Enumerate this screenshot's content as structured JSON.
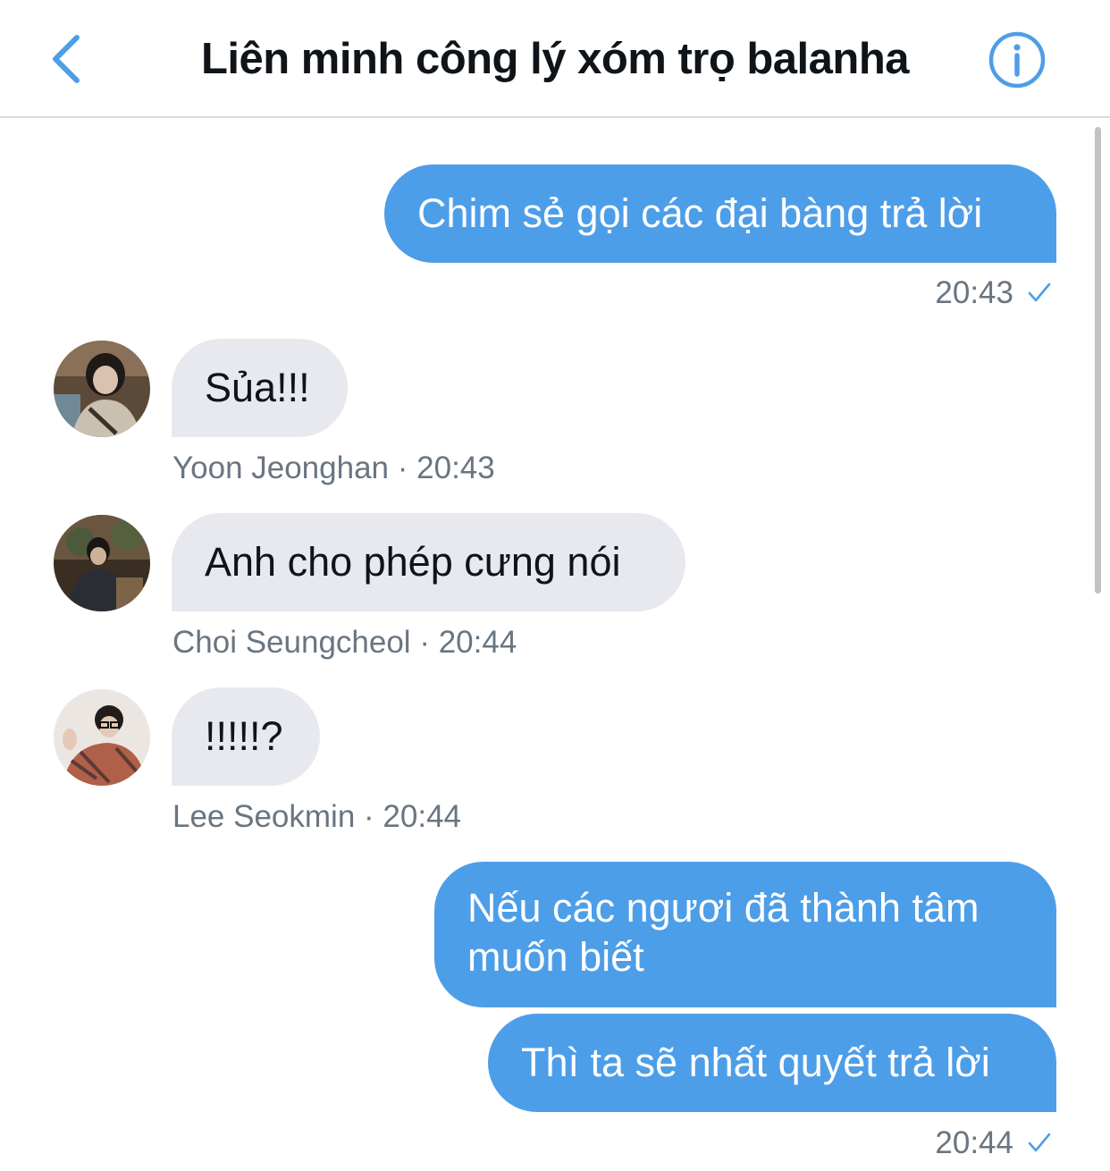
{
  "header": {
    "title": "Liên minh công lý xóm trọ balanha",
    "back_icon": "chevron-left-icon",
    "info_icon": "info-circle-icon",
    "accent": "#4d9ee8"
  },
  "messages": [
    {
      "direction": "outgoing",
      "text": "Chim sẻ gọi các đại bàng trả lời",
      "time": "20:43",
      "status": "sent-check-icon"
    },
    {
      "direction": "incoming",
      "text": "Sủa!!!",
      "sender": "Yoon Jeonghan",
      "separator": "·",
      "time": "20:43",
      "avatar": "avatar-yoon-jeonghan"
    },
    {
      "direction": "incoming",
      "text": "Anh cho phép cưng nói",
      "sender": "Choi Seungcheol",
      "separator": "·",
      "time": "20:44",
      "avatar": "avatar-choi-seungcheol"
    },
    {
      "direction": "incoming",
      "text": "!!!!!?",
      "sender": "Lee Seokmin",
      "separator": "·",
      "time": "20:44",
      "avatar": "avatar-lee-seokmin"
    },
    {
      "direction": "outgoing",
      "text_lines": [
        "Nếu các ngươi đã thành tâm",
        "muốn biết"
      ]
    },
    {
      "direction": "outgoing",
      "text": "Thì ta sẽ nhất quyết trả lời",
      "time": "20:44",
      "status": "sent-check-icon"
    }
  ],
  "colors": {
    "outgoing_bubble": "#4d9ee8",
    "incoming_bubble": "#e7e9ee",
    "meta_text": "#697581"
  }
}
